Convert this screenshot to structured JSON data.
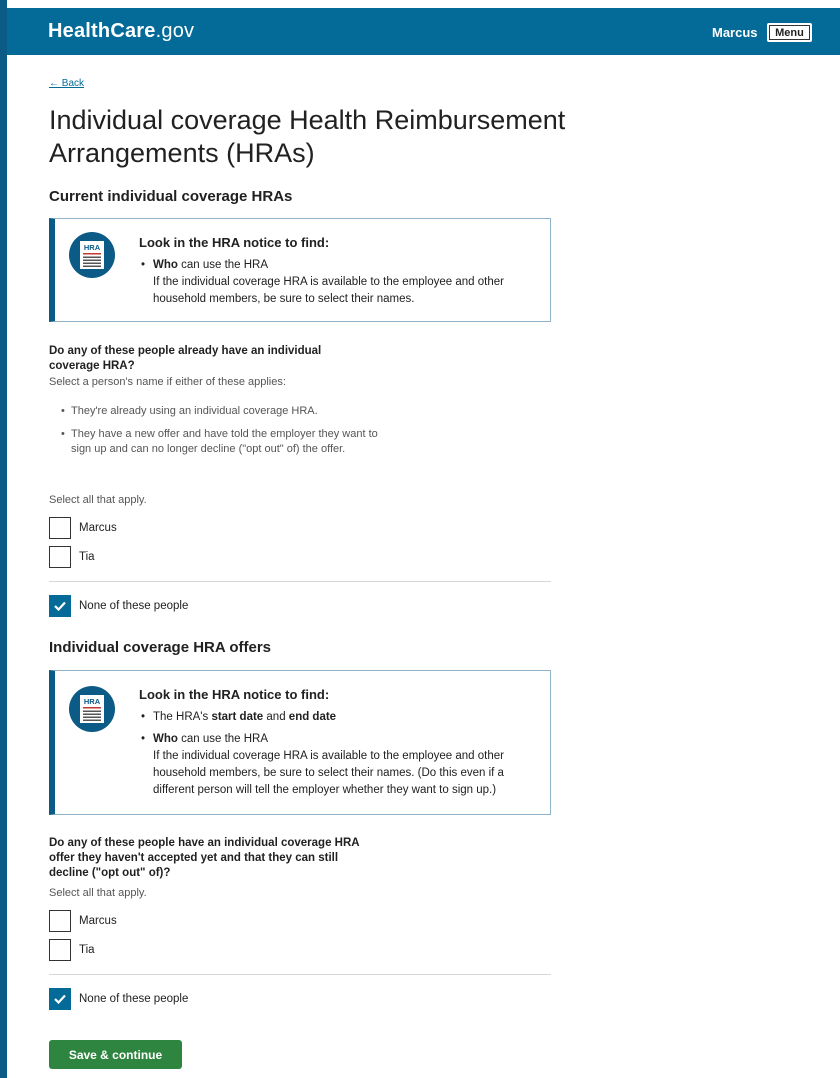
{
  "header": {
    "logo_bold": "HealthCare",
    "logo_rest": ".gov",
    "user_name": "Marcus",
    "menu_label": "Menu"
  },
  "back_link": "← Back",
  "page_title": "Individual coverage Health Reimbursement Arrangements (HRAs)",
  "section1": {
    "title": "Current individual coverage HRAs",
    "notice": {
      "icon_label": "HRA",
      "title": "Look in the HRA notice to find:",
      "items": [
        {
          "bold": "Who",
          "text": " can use the HRA",
          "detail": "If the individual coverage HRA is available to the employee and other household members, be sure to select their names."
        }
      ]
    },
    "question": "Do any of these people already have an individual coverage HRA?",
    "hint": "Select a person's name if either of these applies:",
    "bullets": [
      "They're already using an individual coverage HRA.",
      "They have a new offer and have told the employer they want to sign up and can no longer decline (\"opt out\" of) the offer."
    ],
    "select_hint": "Select all that apply.",
    "options": [
      {
        "label": "Marcus",
        "checked": false
      },
      {
        "label": "Tia",
        "checked": false
      }
    ],
    "none_option": {
      "label": "None of these people",
      "checked": true
    }
  },
  "section2": {
    "title": "Individual coverage HRA offers",
    "notice": {
      "icon_label": "HRA",
      "title": "Look in the HRA notice to find:",
      "item1_pre": "The HRA's ",
      "item1_b1": "start date",
      "item1_mid": " and ",
      "item1_b2": "end date",
      "item2_bold": "Who",
      "item2_text": " can use the HRA",
      "item2_detail": "If the individual coverage HRA is available to the employee and other household members, be sure to select their names. (Do this even if a different person will tell the employer whether they want to sign up.)"
    },
    "question": "Do any of these people have an individual coverage HRA offer they haven't accepted yet and that they can still decline (\"opt out\" of)?",
    "select_hint": "Select all that apply.",
    "options": [
      {
        "label": "Marcus",
        "checked": false
      },
      {
        "label": "Tia",
        "checked": false
      }
    ],
    "none_option": {
      "label": "None of these people",
      "checked": true
    }
  },
  "submit_label": "Save & continue",
  "colors": {
    "header_bg": "#046b99",
    "accent": "#0b5b86",
    "checked_bg": "#046b99",
    "submit_bg": "#2e8540"
  }
}
